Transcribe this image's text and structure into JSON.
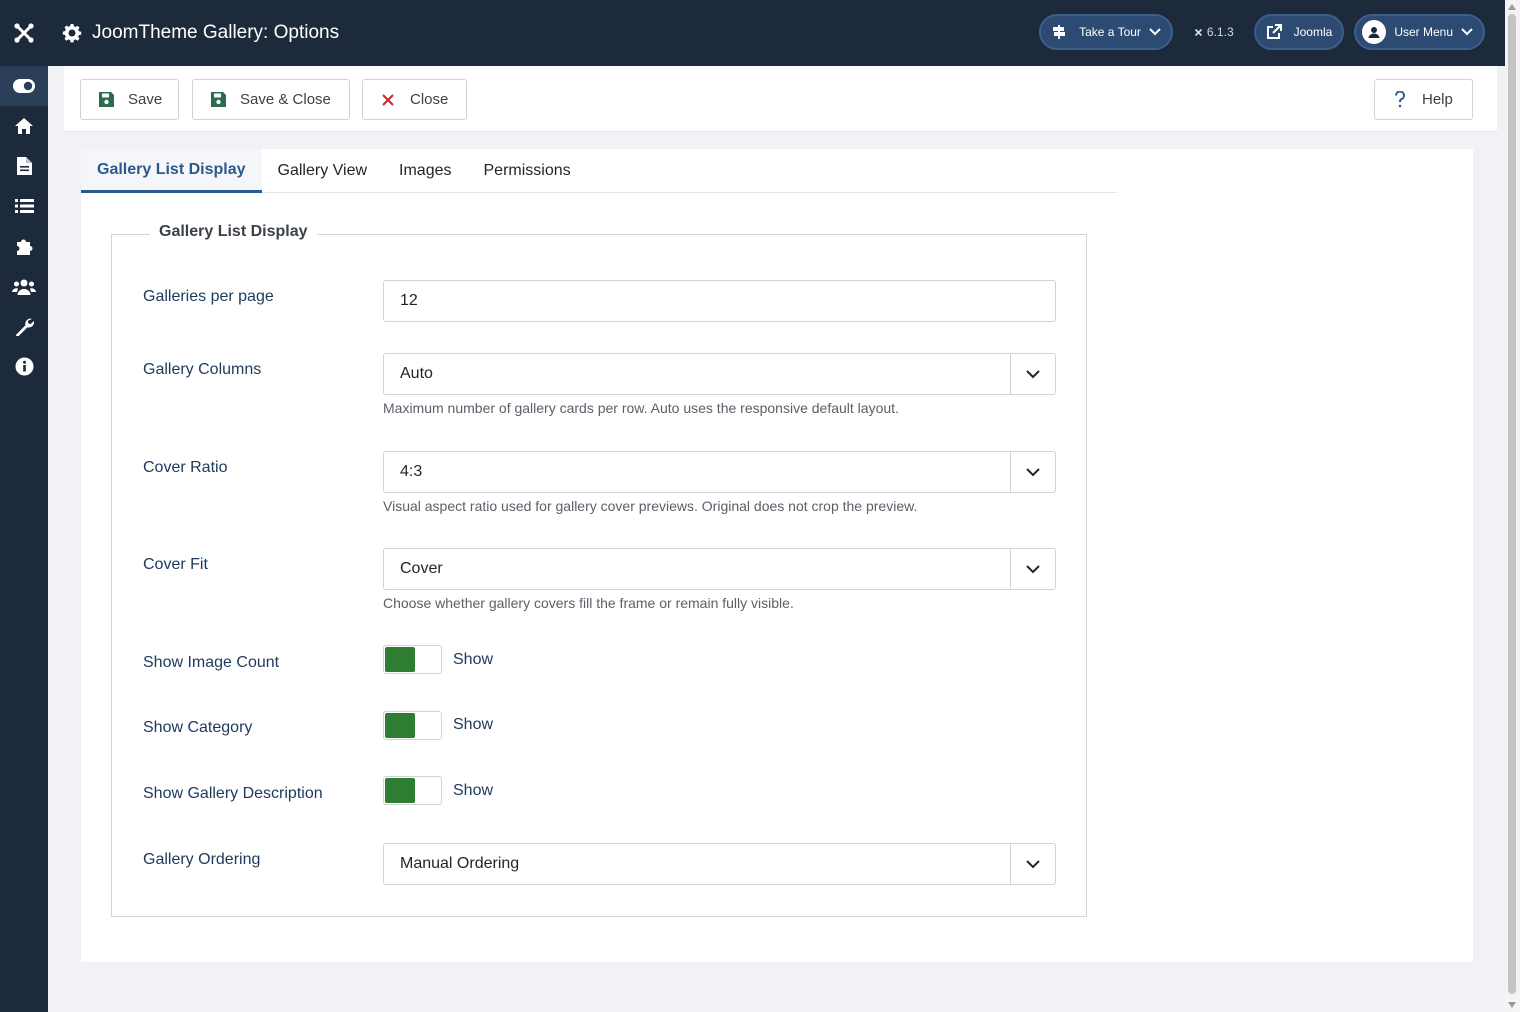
{
  "header": {
    "title": "JoomTheme Gallery: Options",
    "tour_label": "Take a Tour",
    "version": "6.1.3",
    "site_label": "Joomla",
    "user_menu_label": "User Menu"
  },
  "sidebar": {
    "items": [
      {
        "icon": "toggle-icon",
        "active": true
      },
      {
        "icon": "home-icon"
      },
      {
        "icon": "file-icon"
      },
      {
        "icon": "list-icon"
      },
      {
        "icon": "puzzle-icon"
      },
      {
        "icon": "users-icon"
      },
      {
        "icon": "wrench-icon"
      },
      {
        "icon": "info-icon"
      }
    ]
  },
  "toolbar": {
    "save_label": "Save",
    "save_close_label": "Save & Close",
    "close_label": "Close",
    "help_label": "Help"
  },
  "tabs": [
    {
      "label": "Gallery List Display",
      "active": true
    },
    {
      "label": "Gallery View"
    },
    {
      "label": "Images"
    },
    {
      "label": "Permissions"
    }
  ],
  "form": {
    "legend": "Gallery List Display",
    "galleries_per_page": {
      "label": "Galleries per page",
      "value": "12"
    },
    "gallery_columns": {
      "label": "Gallery Columns",
      "value": "Auto",
      "help": "Maximum number of gallery cards per row. Auto uses the responsive default layout."
    },
    "cover_ratio": {
      "label": "Cover Ratio",
      "value": "4:3",
      "help": "Visual aspect ratio used for gallery cover previews. Original does not crop the preview."
    },
    "cover_fit": {
      "label": "Cover Fit",
      "value": "Cover",
      "help": "Choose whether gallery covers fill the frame or remain fully visible."
    },
    "show_image_count": {
      "label": "Show Image Count",
      "state": "Show"
    },
    "show_category": {
      "label": "Show Category",
      "state": "Show"
    },
    "show_gallery_description": {
      "label": "Show Gallery Description",
      "state": "Show"
    },
    "gallery_ordering": {
      "label": "Gallery Ordering",
      "value": "Manual Ordering"
    }
  },
  "colors": {
    "header_bg": "#1c2a3c",
    "switch_on": "#2e7d32",
    "tab_active": "#2d5a8c"
  }
}
